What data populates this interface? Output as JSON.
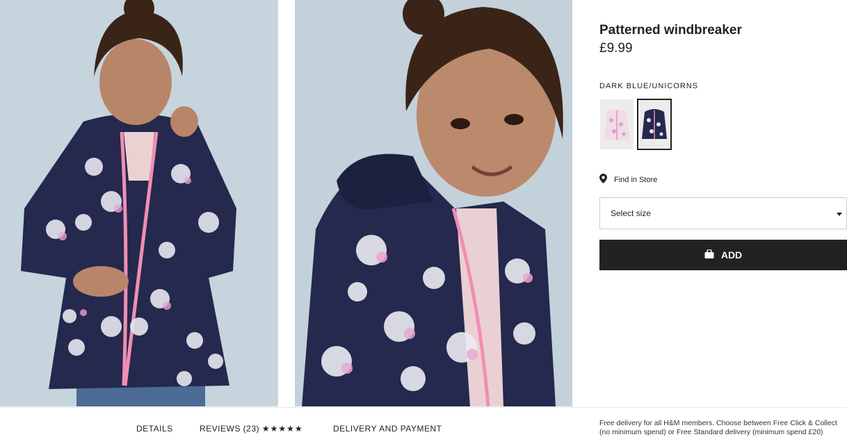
{
  "product": {
    "title": "Patterned windbreaker",
    "price": "£9.99",
    "color_label": "DARK BLUE/UNICORNS",
    "swatches": [
      {
        "name": "light pink unicorns",
        "color": "#f2dbe3",
        "selected": false
      },
      {
        "name": "dark blue unicorns",
        "color": "#24294d",
        "selected": true
      }
    ],
    "find_in_store": "Find in Store",
    "size_placeholder": "Select size",
    "add_label": "ADD"
  },
  "tabs": {
    "details": "DETAILS",
    "reviews": "REVIEWS (23)",
    "reviews_stars": "★★★★★",
    "delivery": "DELIVERY AND PAYMENT"
  },
  "delivery_note": {
    "line1": "Free delivery for all H&M members. Choose between Free Click & Collect",
    "line2": "(no minimum spend) or Free Standard delivery (minimum spend £20)"
  },
  "colors": {
    "button_bg": "#222222",
    "jacket_navy": "#24294d",
    "zip_pink": "#f28db4",
    "photo_bg": "#c5d3dd"
  }
}
